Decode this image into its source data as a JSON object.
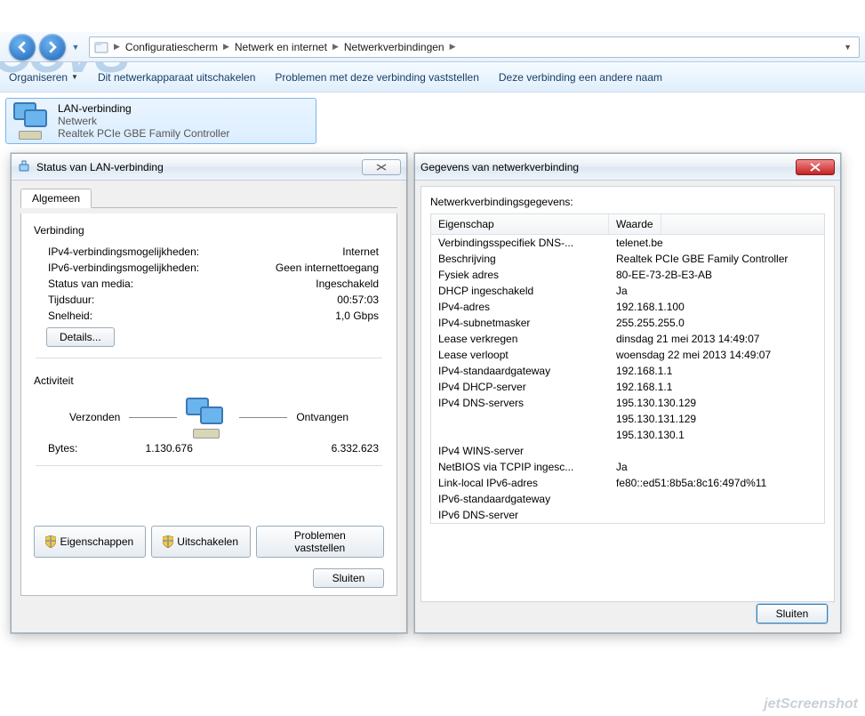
{
  "logo": "CCVS",
  "breadcrumbs": [
    "Configuratiescherm",
    "Netwerk en internet",
    "Netwerkverbindingen"
  ],
  "toolbar": {
    "organize": "Organiseren",
    "disable_device": "Dit netwerkapparaat uitschakelen",
    "diagnose": "Problemen met deze verbinding vaststellen",
    "rename": "Deze verbinding een andere naam"
  },
  "connection": {
    "name": "LAN-verbinding",
    "network": "Netwerk",
    "adapter": "Realtek PCIe GBE Family Controller"
  },
  "status_dialog": {
    "title": "Status van LAN-verbinding",
    "tab": "Algemeen",
    "section_conn": "Verbinding",
    "rows": {
      "ipv4_label": "IPv4-verbindingsmogelijkheden:",
      "ipv4_value": "Internet",
      "ipv6_label": "IPv6-verbindingsmogelijkheden:",
      "ipv6_value": "Geen internettoegang",
      "media_label": "Status van media:",
      "media_value": "Ingeschakeld",
      "duration_label": "Tijdsduur:",
      "duration_value": "00:57:03",
      "speed_label": "Snelheid:",
      "speed_value": "1,0 Gbps"
    },
    "details_btn": "Details...",
    "section_act": "Activiteit",
    "sent_label": "Verzonden",
    "recv_label": "Ontvangen",
    "bytes_label": "Bytes:",
    "bytes_sent": "1.130.676",
    "bytes_recv": "6.332.623",
    "btn_props": "Eigenschappen",
    "btn_disable": "Uitschakelen",
    "btn_diag": "Problemen vaststellen",
    "btn_close": "Sluiten"
  },
  "details_dialog": {
    "title": "Gegevens van netwerkverbinding",
    "subtitle": "Netwerkverbindingsgegevens:",
    "col1": "Eigenschap",
    "col2": "Waarde",
    "rows": [
      {
        "p": "Verbindingsspecifiek DNS-...",
        "v": "telenet.be"
      },
      {
        "p": "Beschrijving",
        "v": "Realtek PCIe GBE Family Controller"
      },
      {
        "p": "Fysiek adres",
        "v": "80-EE-73-2B-E3-AB"
      },
      {
        "p": "DHCP ingeschakeld",
        "v": "Ja"
      },
      {
        "p": "IPv4-adres",
        "v": "192.168.1.100"
      },
      {
        "p": "IPv4-subnetmasker",
        "v": "255.255.255.0"
      },
      {
        "p": "Lease verkregen",
        "v": "dinsdag 21 mei 2013 14:49:07"
      },
      {
        "p": "Lease verloopt",
        "v": "woensdag 22 mei 2013 14:49:07"
      },
      {
        "p": "IPv4-standaardgateway",
        "v": "192.168.1.1"
      },
      {
        "p": "IPv4 DHCP-server",
        "v": "192.168.1.1"
      },
      {
        "p": "IPv4 DNS-servers",
        "v": "195.130.130.129"
      },
      {
        "p": "",
        "v": "195.130.131.129"
      },
      {
        "p": "",
        "v": "195.130.130.1"
      },
      {
        "p": "IPv4 WINS-server",
        "v": ""
      },
      {
        "p": "NetBIOS via TCPIP ingesc...",
        "v": "Ja"
      },
      {
        "p": "Link-local IPv6-adres",
        "v": "fe80::ed51:8b5a:8c16:497d%11"
      },
      {
        "p": "IPv6-standaardgateway",
        "v": ""
      },
      {
        "p": "IPv6 DNS-server",
        "v": ""
      }
    ],
    "btn_close": "Sluiten"
  },
  "watermark": "jetScreenshot"
}
